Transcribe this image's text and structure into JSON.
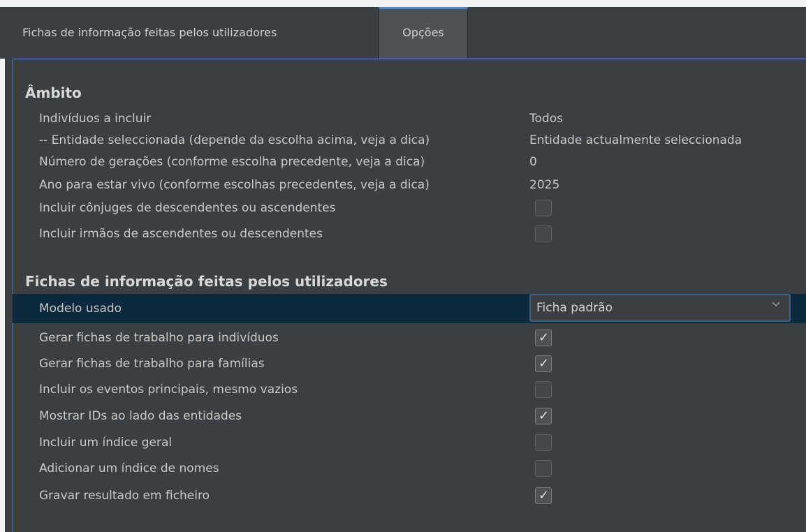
{
  "tabs": [
    {
      "label": "Fichas de informação feitas pelos utilizadores",
      "active": false
    },
    {
      "label": "Opções",
      "active": true
    }
  ],
  "scope": {
    "title": "Âmbito",
    "rows": [
      {
        "label": "Indivíduos a incluir",
        "value": "Todos"
      },
      {
        "label": "-- Entidade seleccionada  (depende da escolha acima, veja a dica)",
        "value": "Entidade actualmente seleccionada"
      },
      {
        "label": "Número de gerações (conforme escolha precedente, veja a dica)",
        "value": "0"
      },
      {
        "label": "Ano para estar vivo (conforme escolhas precedentes, veja a dica)",
        "value": "2025"
      },
      {
        "label": "Incluir cônjuges de descendentes ou ascendentes",
        "checked": false
      },
      {
        "label": "Incluir irmãos de ascendentes ou descendentes",
        "checked": false
      }
    ]
  },
  "sheets": {
    "title": "Fichas de informação feitas pelos utilizadores",
    "model_label": "Modelo usado",
    "model_value": "Ficha padrão",
    "rows": [
      {
        "label": "Gerar fichas de trabalho para indivíduos",
        "checked": true
      },
      {
        "label": "Gerar fichas de trabalho para famílias",
        "checked": true
      },
      {
        "label": "Incluir os eventos principais, mesmo vazios",
        "checked": false
      },
      {
        "label": "Mostrar IDs ao lado das entidades",
        "checked": true
      },
      {
        "label": "Incluir um índice geral",
        "checked": false
      },
      {
        "label": "Adicionar um índice de nomes",
        "checked": false
      },
      {
        "label": "Gravar resultado em ficheiro",
        "checked": true
      }
    ]
  },
  "icons": {
    "check": "check-icon",
    "chevron": "chevron-down-icon"
  }
}
